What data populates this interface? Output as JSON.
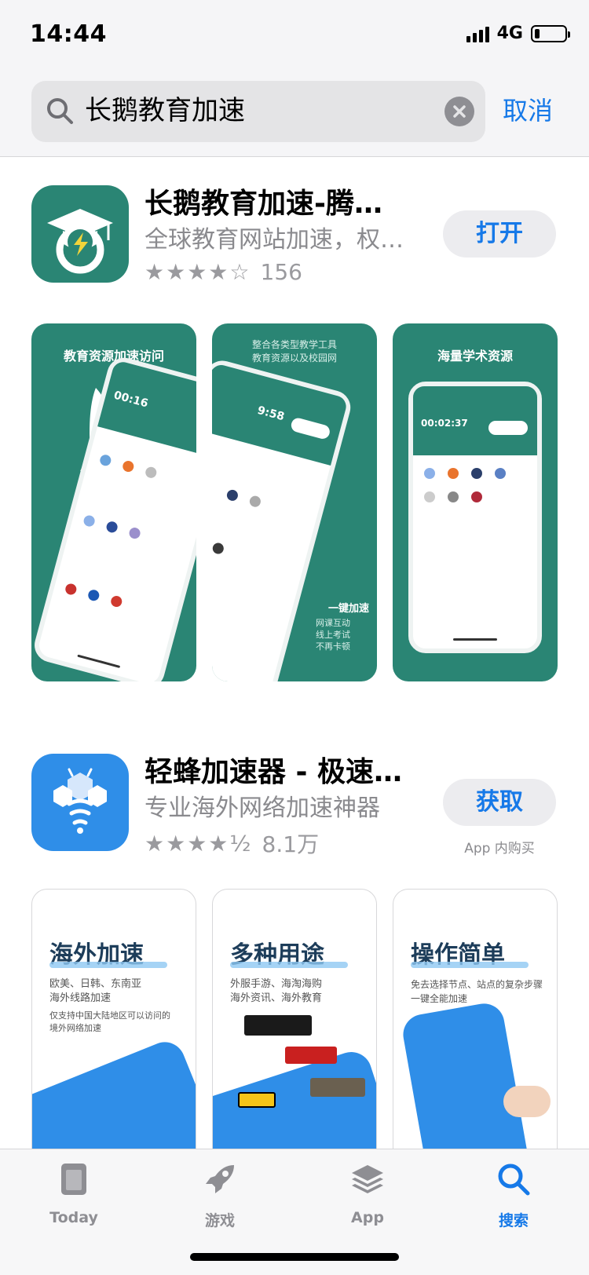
{
  "status": {
    "time": "14:44",
    "network": "4G"
  },
  "search": {
    "query": "长鹅教育加速",
    "cancel_label": "取消"
  },
  "apps": [
    {
      "title": "长鹅教育加速-腾…",
      "subtitle": "全球教育网站加速，权…",
      "stars": "★★★★☆",
      "rating_count": "156",
      "button_label": "打开",
      "icon_color": "#2a8574",
      "screenshots": [
        {
          "caption": "教育资源加速访问",
          "timer": "00:16"
        },
        {
          "caption": "整合各类型教学工具",
          "subcaption": "教育资源以及校园网",
          "timer": "9:58",
          "bottom_title": "一键加速",
          "bottom_lines": [
            "网课互动",
            "线上考试",
            "不再卡顿"
          ]
        },
        {
          "caption": "海量学术资源",
          "timer": "00:02:37"
        }
      ]
    },
    {
      "title": "轻蜂加速器 - 极速…",
      "subtitle": "专业海外网络加速神器",
      "stars": "★★★★½",
      "rating_count": "8.1万",
      "button_label": "获取",
      "iap_note": "App 内购买",
      "icon_color": "#2f8ee8",
      "screenshots": [
        {
          "caption": "海外加速",
          "lines": [
            "欧美、日韩、东南亚",
            "海外线路加速",
            "仅支持中国大陆地区可以访问的",
            "境外网络加速"
          ]
        },
        {
          "caption": "多种用途",
          "lines": [
            "外服手游、海淘海购",
            "海外资讯、海外教育"
          ]
        },
        {
          "caption": "操作简单",
          "lines": [
            "免去选择节点、站点的复杂步骤",
            "一键全能加速"
          ]
        }
      ]
    }
  ],
  "tabs": [
    {
      "label": "Today",
      "icon": "today-icon"
    },
    {
      "label": "游戏",
      "icon": "rocket-icon"
    },
    {
      "label": "App",
      "icon": "layers-icon"
    },
    {
      "label": "搜索",
      "icon": "search-icon",
      "active": true
    }
  ],
  "colors": {
    "accent": "#1679e8",
    "teal": "#2a8574",
    "blue": "#2f8ee8"
  }
}
